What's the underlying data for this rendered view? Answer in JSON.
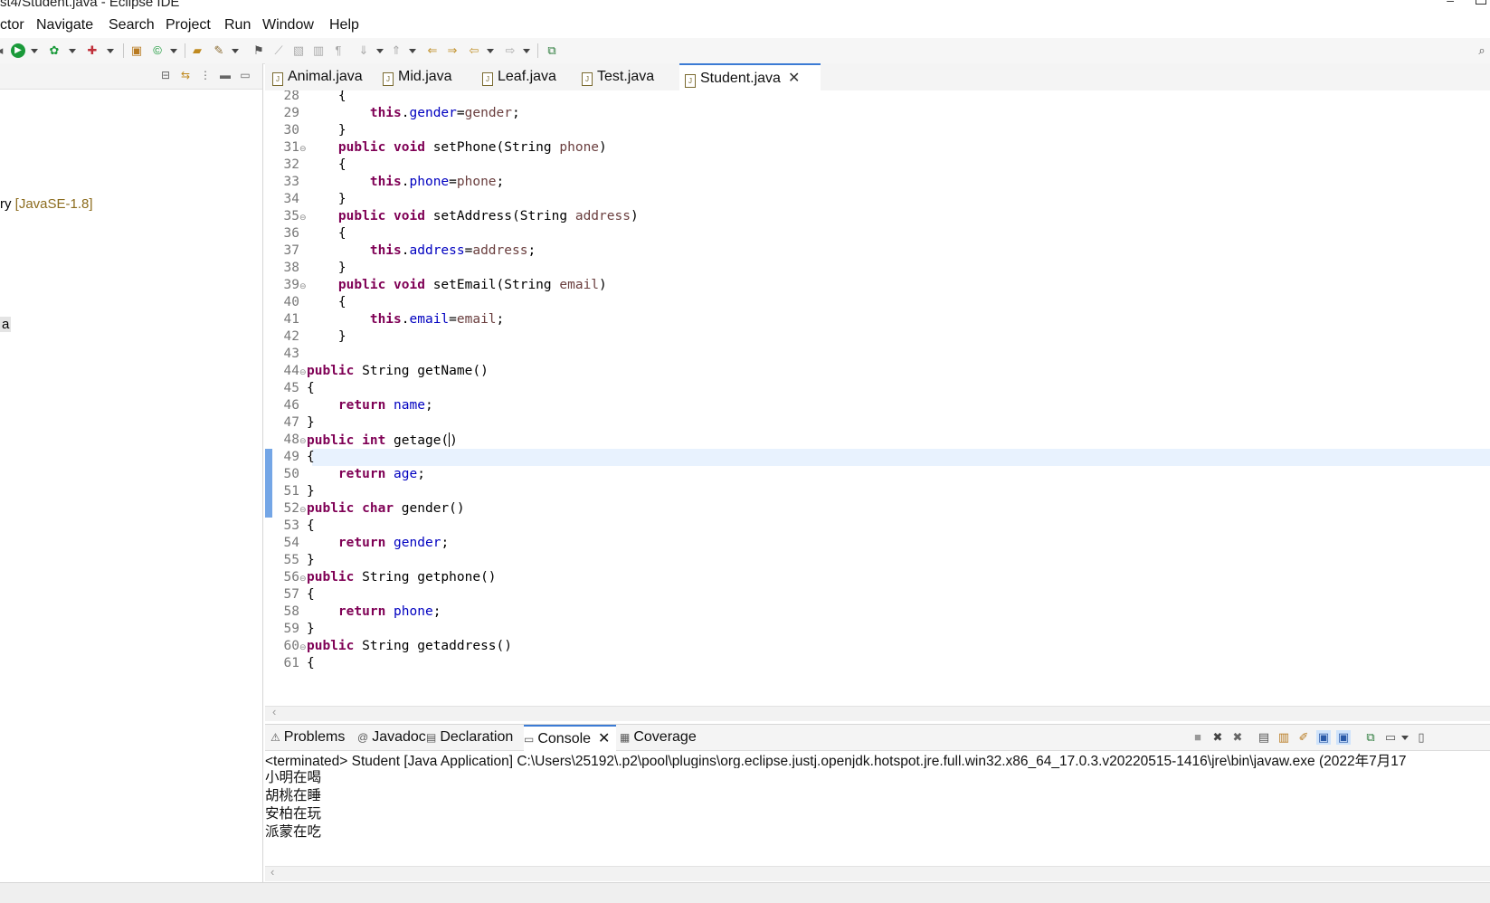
{
  "window": {
    "title": "st4/Student.java - Eclipse IDE"
  },
  "menu": [
    "ctor",
    "Navigate",
    "Search",
    "Project",
    "Run",
    "Window",
    "Help"
  ],
  "left_panel": {
    "tree_item_jre": {
      "prefix": "ry",
      "label": "[JavaSE-1.8]"
    },
    "tree_item_selected": "a"
  },
  "editor": {
    "tabs": [
      {
        "label": "Animal.java",
        "active": false
      },
      {
        "label": "Mid.java",
        "active": false
      },
      {
        "label": "Leaf.java",
        "active": false
      },
      {
        "label": "Test.java",
        "active": false
      },
      {
        "label": "Student.java",
        "active": true
      }
    ],
    "current_line": 48,
    "lines": [
      {
        "n": "28",
        "tokens": [
          [
            "",
            "    {"
          ]
        ]
      },
      {
        "n": "29",
        "tokens": [
          [
            "",
            "        "
          ],
          [
            "kw",
            "this"
          ],
          [
            "",
            "."
          ],
          [
            "fld",
            "gender"
          ],
          [
            "",
            "="
          ],
          [
            "prm",
            "gender"
          ],
          [
            "",
            ";"
          ]
        ]
      },
      {
        "n": "30",
        "tokens": [
          [
            "",
            "    }"
          ]
        ]
      },
      {
        "n": "31",
        "fold": true,
        "tokens": [
          [
            "",
            "    "
          ],
          [
            "kw",
            "public"
          ],
          [
            "",
            " "
          ],
          [
            "kw",
            "void"
          ],
          [
            "",
            " setPhone(String "
          ],
          [
            "prm",
            "phone"
          ],
          [
            "",
            ")"
          ]
        ]
      },
      {
        "n": "32",
        "tokens": [
          [
            "",
            "    {"
          ]
        ]
      },
      {
        "n": "33",
        "tokens": [
          [
            "",
            "        "
          ],
          [
            "kw",
            "this"
          ],
          [
            "",
            "."
          ],
          [
            "fld",
            "phone"
          ],
          [
            "",
            "="
          ],
          [
            "prm",
            "phone"
          ],
          [
            "",
            ";"
          ]
        ]
      },
      {
        "n": "34",
        "tokens": [
          [
            "",
            "    }"
          ]
        ]
      },
      {
        "n": "35",
        "fold": true,
        "tokens": [
          [
            "",
            "    "
          ],
          [
            "kw",
            "public"
          ],
          [
            "",
            " "
          ],
          [
            "kw",
            "void"
          ],
          [
            "",
            " setAddress(String "
          ],
          [
            "prm",
            "address"
          ],
          [
            "",
            ")"
          ]
        ]
      },
      {
        "n": "36",
        "tokens": [
          [
            "",
            "    {"
          ]
        ]
      },
      {
        "n": "37",
        "tokens": [
          [
            "",
            "        "
          ],
          [
            "kw",
            "this"
          ],
          [
            "",
            "."
          ],
          [
            "fld",
            "address"
          ],
          [
            "",
            "="
          ],
          [
            "prm",
            "address"
          ],
          [
            "",
            ";"
          ]
        ]
      },
      {
        "n": "38",
        "tokens": [
          [
            "",
            "    }"
          ]
        ]
      },
      {
        "n": "39",
        "fold": true,
        "tokens": [
          [
            "",
            "    "
          ],
          [
            "kw",
            "public"
          ],
          [
            "",
            " "
          ],
          [
            "kw",
            "void"
          ],
          [
            "",
            " setEmail(String "
          ],
          [
            "prm",
            "email"
          ],
          [
            "",
            ")"
          ]
        ]
      },
      {
        "n": "40",
        "tokens": [
          [
            "",
            "    {"
          ]
        ]
      },
      {
        "n": "41",
        "tokens": [
          [
            "",
            "        "
          ],
          [
            "kw",
            "this"
          ],
          [
            "",
            "."
          ],
          [
            "fld",
            "email"
          ],
          [
            "",
            "="
          ],
          [
            "prm",
            "email"
          ],
          [
            "",
            ";"
          ]
        ]
      },
      {
        "n": "42",
        "tokens": [
          [
            "",
            "    }"
          ]
        ]
      },
      {
        "n": "43",
        "tokens": []
      },
      {
        "n": "44",
        "fold": true,
        "tokens": [
          [
            "kw",
            "public"
          ],
          [
            "",
            " String getName()"
          ]
        ]
      },
      {
        "n": "45",
        "tokens": [
          [
            "",
            "{"
          ]
        ]
      },
      {
        "n": "46",
        "tokens": [
          [
            "",
            "    "
          ],
          [
            "kw",
            "return"
          ],
          [
            "",
            " "
          ],
          [
            "fld",
            "name"
          ],
          [
            "",
            ";"
          ]
        ]
      },
      {
        "n": "47",
        "tokens": [
          [
            "",
            "}"
          ]
        ]
      },
      {
        "n": "48",
        "fold": true,
        "caret": true,
        "tokens": [
          [
            "kw",
            "public"
          ],
          [
            "",
            " "
          ],
          [
            "kw",
            "int"
          ],
          [
            "",
            " getage("
          ],
          [
            "caret",
            ""
          ],
          [
            "",
            ")"
          ]
        ]
      },
      {
        "n": "49",
        "tokens": [
          [
            "",
            "{"
          ]
        ]
      },
      {
        "n": "50",
        "tokens": [
          [
            "",
            "    "
          ],
          [
            "kw",
            "return"
          ],
          [
            "",
            " "
          ],
          [
            "fld",
            "age"
          ],
          [
            "",
            ";"
          ]
        ]
      },
      {
        "n": "51",
        "tokens": [
          [
            "",
            "}"
          ]
        ]
      },
      {
        "n": "52",
        "fold": true,
        "tokens": [
          [
            "kw",
            "public"
          ],
          [
            "",
            " "
          ],
          [
            "kw",
            "char"
          ],
          [
            "",
            " gender()"
          ]
        ]
      },
      {
        "n": "53",
        "tokens": [
          [
            "",
            "{"
          ]
        ]
      },
      {
        "n": "54",
        "tokens": [
          [
            "",
            "    "
          ],
          [
            "kw",
            "return"
          ],
          [
            "",
            " "
          ],
          [
            "fld",
            "gender"
          ],
          [
            "",
            ";"
          ]
        ]
      },
      {
        "n": "55",
        "tokens": [
          [
            "",
            "}"
          ]
        ]
      },
      {
        "n": "56",
        "fold": true,
        "tokens": [
          [
            "kw",
            "public"
          ],
          [
            "",
            " String getphone()"
          ]
        ]
      },
      {
        "n": "57",
        "tokens": [
          [
            "",
            "{"
          ]
        ]
      },
      {
        "n": "58",
        "tokens": [
          [
            "",
            "    "
          ],
          [
            "kw",
            "return"
          ],
          [
            "",
            " "
          ],
          [
            "fld",
            "phone"
          ],
          [
            "",
            ";"
          ]
        ]
      },
      {
        "n": "59",
        "tokens": [
          [
            "",
            "}"
          ]
        ]
      },
      {
        "n": "60",
        "fold": true,
        "tokens": [
          [
            "kw",
            "public"
          ],
          [
            "",
            " String getaddress()"
          ]
        ]
      },
      {
        "n": "61",
        "tokens": [
          [
            "",
            "{"
          ]
        ]
      }
    ]
  },
  "console": {
    "tabs": [
      {
        "label": "Problems",
        "icon": "problems-icon",
        "glyph": "⚠",
        "active": false
      },
      {
        "label": "Javadoc",
        "icon": "javadoc-icon",
        "glyph": "@",
        "active": false
      },
      {
        "label": "Declaration",
        "icon": "declaration-icon",
        "glyph": "▤",
        "active": false
      },
      {
        "label": "Console",
        "icon": "console-icon",
        "glyph": "▭",
        "active": true
      },
      {
        "label": "Coverage",
        "icon": "coverage-icon",
        "glyph": "▦",
        "active": false
      }
    ],
    "header": "<terminated> Student [Java Application] C:\\Users\\25192\\.p2\\pool\\plugins\\org.eclipse.justj.openjdk.hotspot.jre.full.win32.x86_64_17.0.3.v20220515-1416\\jre\\bin\\javaw.exe  (2022年7月17",
    "output": [
      "小明在喝",
      "胡桃在睡",
      "安柏在玩",
      "派蒙在吃"
    ]
  },
  "colors": {
    "keyword": "#7f0055",
    "field": "#0000c0",
    "parameter": "#6a3e3e",
    "current_line": "#e8f2fe",
    "accent": "#3b7bd4"
  }
}
